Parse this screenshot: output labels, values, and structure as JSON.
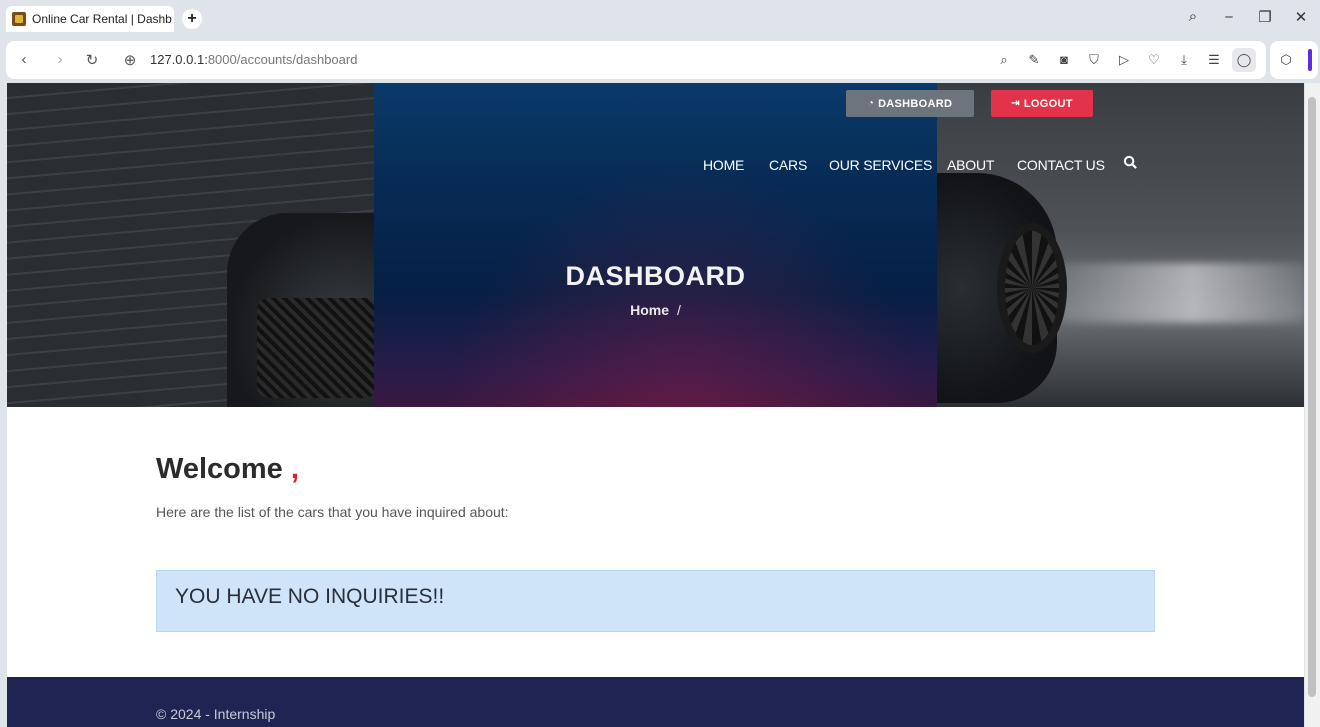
{
  "browser": {
    "tab_title": "Online Car Rental | Dashb",
    "new_tab": "+",
    "url_host": "127.0.0.1:",
    "url_path": "8000/accounts/dashboard",
    "controls": {
      "minimize": "⎯",
      "restore": "❐",
      "close": "✕",
      "search": "⌕"
    },
    "nav": {
      "back": "‹",
      "forward": "›",
      "reload": "↻",
      "site_info": "⊕"
    }
  },
  "header": {
    "dashboard_button": "DASHBOARD",
    "logout_button": "LOGOUT",
    "nav": [
      "HOME",
      "CARS",
      "OUR SERVICES",
      "ABOUT",
      "CONTACT US"
    ],
    "title": "DASHBOARD",
    "breadcrumb_home": "Home",
    "breadcrumb_sep": "/"
  },
  "main": {
    "welcome": "Welcome",
    "welcome_comma": ",",
    "subtext": "Here are the list of the cars that you have inquired about:",
    "alert": "YOU HAVE NO INQUIRIES!!"
  },
  "footer": {
    "text": "© 2024 - Internship"
  },
  "colors": {
    "logout": "#e2334b",
    "dashboard": "#6c757d",
    "alert_bg": "#cfe4f9",
    "footer_bg": "#1f2452"
  }
}
